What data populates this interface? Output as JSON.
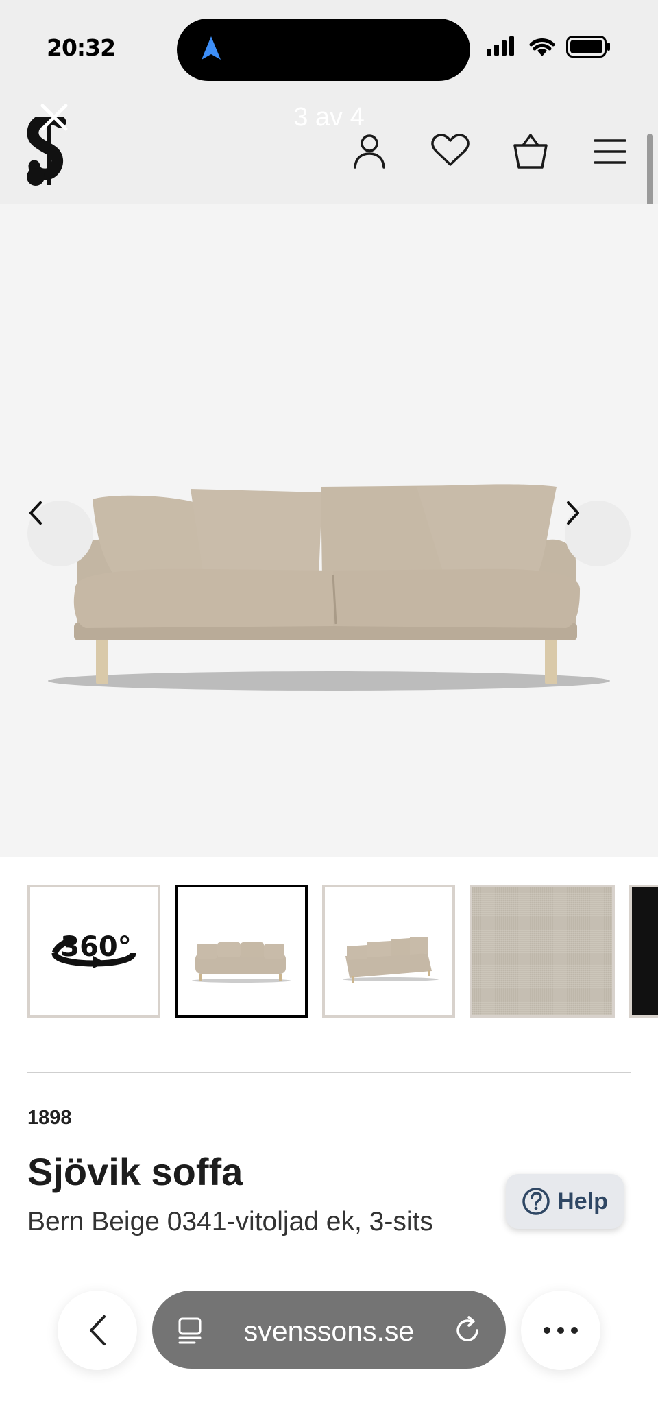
{
  "status_bar": {
    "time": "20:32",
    "icons": [
      "navigation-arrow-icon",
      "cellular-signal-icon",
      "wifi-icon",
      "battery-icon"
    ]
  },
  "header": {
    "logo": "svenssons-logo",
    "image_counter": "3 av 4",
    "icons": [
      "close-icon",
      "account-icon",
      "heart-icon",
      "basket-icon",
      "menu-icon"
    ]
  },
  "gallery": {
    "thumbnails": [
      {
        "name": "thumb-360",
        "label": "360°",
        "selected": false
      },
      {
        "name": "thumb-front",
        "selected": true
      },
      {
        "name": "thumb-angle",
        "selected": false
      },
      {
        "name": "thumb-fabric",
        "selected": false
      },
      {
        "name": "thumb-dark",
        "selected": false
      }
    ],
    "prev_icon": "chevron-left-icon",
    "next_icon": "chevron-right-icon"
  },
  "product": {
    "brand": "1898",
    "title": "Sjövik soffa",
    "subtitle": "Bern Beige 0341-vitoljad ek, 3-sits"
  },
  "help": {
    "label": "Help"
  },
  "browser": {
    "url": "svenssons.se"
  },
  "colors": {
    "header_bg": "#eeeeee",
    "hero_bg": "#f4f4f4",
    "sofa": "#c5b8a6",
    "help_text": "#2f4764",
    "urlbar": "#747474"
  }
}
